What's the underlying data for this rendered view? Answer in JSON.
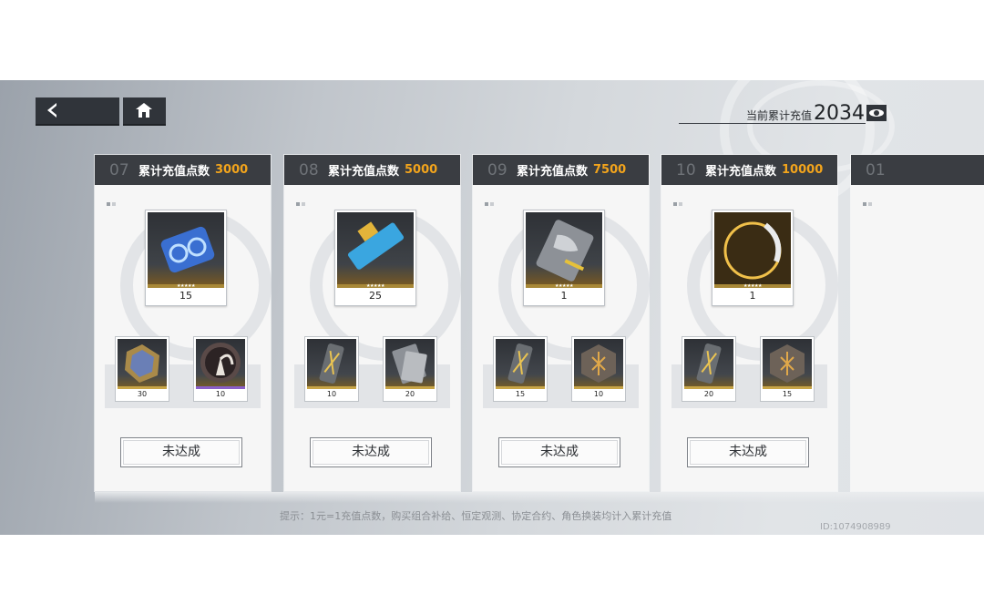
{
  "header": {
    "topup_label": "当前累计充值",
    "topup_value": "2034"
  },
  "cards": [
    {
      "num": "07",
      "label": "累计充值点数",
      "target": "3000",
      "main": {
        "qty": "15",
        "stars": "★★★★★",
        "icon": "blue-engine-part-icon"
      },
      "subs": [
        {
          "qty": "30",
          "stars": "★★★★★",
          "icon": "iridescent-crystal-icon",
          "bar_color": "#c8a547"
        },
        {
          "qty": "10",
          "stars": "★★★★",
          "icon": "winged-emblem-coin-icon",
          "bar_color": "#8a5fc9"
        }
      ],
      "status": "未达成"
    },
    {
      "num": "08",
      "label": "累计充值点数",
      "target": "5000",
      "main": {
        "qty": "25",
        "stars": "★★★★★",
        "icon": "blue-weapon-part-icon"
      },
      "subs": [
        {
          "qty": "10",
          "stars": "★★★★★",
          "icon": "gold-crystal-tube-icon",
          "bar_color": "#c8a547"
        },
        {
          "qty": "20",
          "stars": "★★★★★",
          "icon": "metal-plate-icon",
          "bar_color": "#c8a547"
        }
      ],
      "status": "未达成"
    },
    {
      "num": "09",
      "label": "累计充值点数",
      "target": "7500",
      "main": {
        "qty": "1",
        "stars": "★★★★★",
        "icon": "camo-card-icon"
      },
      "subs": [
        {
          "qty": "15",
          "stars": "★★★★★",
          "icon": "gold-crystal-tube-icon",
          "bar_color": "#c8a547"
        },
        {
          "qty": "10",
          "stars": "★★★★★",
          "icon": "rune-cube-icon",
          "bar_color": "#c8a547"
        }
      ],
      "status": "未达成"
    },
    {
      "num": "10",
      "label": "累计充值点数",
      "target": "10000",
      "main": {
        "qty": "1",
        "stars": "★★★★★",
        "icon": "golden-ring-icon"
      },
      "subs": [
        {
          "qty": "20",
          "stars": "★★★★★",
          "icon": "gold-crystal-tube-icon",
          "bar_color": "#c8a547"
        },
        {
          "qty": "15",
          "stars": "★★★★★",
          "icon": "rune-cube-icon",
          "bar_color": "#c8a547"
        }
      ],
      "status": "未达成"
    },
    {
      "num": "01",
      "label": "",
      "target": "",
      "main": {
        "qty": "",
        "stars": "",
        "icon": ""
      },
      "subs": [],
      "status": ""
    }
  ],
  "footer": {
    "hint": "提示：1元=1充值点数，购买组合补给、恒定观测、协定合约、角色换装均计入累计充值",
    "id_text": "ID:1074908989"
  },
  "colors": {
    "accent": "#f2a41c",
    "header_bg": "#3a3d42"
  }
}
